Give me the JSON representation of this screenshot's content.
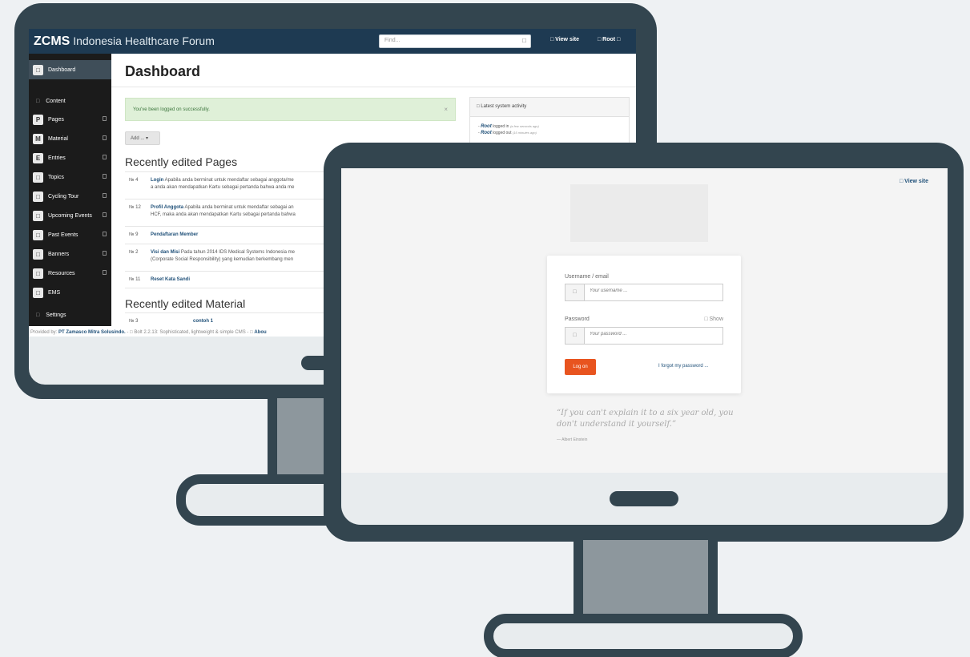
{
  "back": {
    "brand_bold": "ZCMS",
    "brand_text": " Indonesia Healthcare Forum",
    "search_placeholder": "Find...",
    "view_site": "□ View site",
    "user": "□ Root □",
    "sidebar": [
      {
        "badge": "□",
        "label": "Dashboard"
      },
      {
        "badge": "□",
        "label": "Content"
      },
      {
        "badge": "P",
        "label": "Pages"
      },
      {
        "badge": "M",
        "label": "Material"
      },
      {
        "badge": "E",
        "label": "Entries"
      },
      {
        "badge": "□",
        "label": "Topics"
      },
      {
        "badge": "□",
        "label": "Cycling Tour"
      },
      {
        "badge": "□",
        "label": "Upcoming Events"
      },
      {
        "badge": "□",
        "label": "Past Events"
      },
      {
        "badge": "□",
        "label": "Banners"
      },
      {
        "badge": "□",
        "label": "Resources"
      },
      {
        "badge": "□",
        "label": "EMS"
      },
      {
        "badge": "□",
        "label": "Settings"
      }
    ],
    "title": "Dashboard",
    "alert": "You've been logged on successfully.",
    "alert_close": "×",
    "add_button": "Add ... ▾",
    "recent_pages_title": "Recently edited Pages",
    "pages": [
      {
        "num": "№ 4",
        "title": "Login",
        "line1": " Apabila anda berminat untuk mendaftar sebagai anggota/me",
        "line2": "a anda akan mendapatkan Kartu sebagai pertanda bahwa anda me"
      },
      {
        "num": "№ 12",
        "title": "Profil Anggota",
        "line1": " Apabila anda berminat untuk mendaftar sebagai an",
        "line2": "HCF, maka anda akan mendapatkan Kartu sebagai pertanda bahwa"
      },
      {
        "num": "№ 9",
        "title": "Pendaftaran Member",
        "line1": "",
        "line2": ""
      },
      {
        "num": "№ 2",
        "title": "Visi dan Misi",
        "line1": " Pada tahun 2014 IDS Medical Systems Indonesia me",
        "line2": "(Corporate Social Responsibility) yang kemudian berkembang men"
      },
      {
        "num": "№ 11",
        "title": "Reset Kata Sandi",
        "line1": "",
        "line2": ""
      }
    ],
    "recent_material_title": "Recently edited Material",
    "material": [
      {
        "num": "№ 3",
        "title": "contoh 1"
      }
    ],
    "activity_title": "□ Latest system activity",
    "activity": [
      {
        "dash": "- ",
        "user": "Root",
        "action": " logged in ",
        "when": "(a few seconds ago)"
      },
      {
        "dash": "- ",
        "user": "Root",
        "action": " logged out ",
        "when": "(15 minutes ago)"
      }
    ],
    "footer_prefix": "Provided by: ",
    "footer_company": "PT Zamasco Mitra Solusindo.",
    "footer_rest": " - □ Bolt 2.2.13: Sophisticated, lightweight & simple CMS - □ ",
    "footer_about": "Abou"
  },
  "front": {
    "view_site": "□ View site",
    "username_label": "Username / email",
    "username_placeholder": "Your username ...",
    "password_label": "Password",
    "password_placeholder": "Your password ...",
    "show_label": "□ Show",
    "field_icon": "□",
    "login_button": "Log on",
    "forgot_link": "I forgot my password ...",
    "quote": "“If you can't explain it to a six year old, you don't understand it yourself.”",
    "quote_author": "— Albert Einstein"
  }
}
